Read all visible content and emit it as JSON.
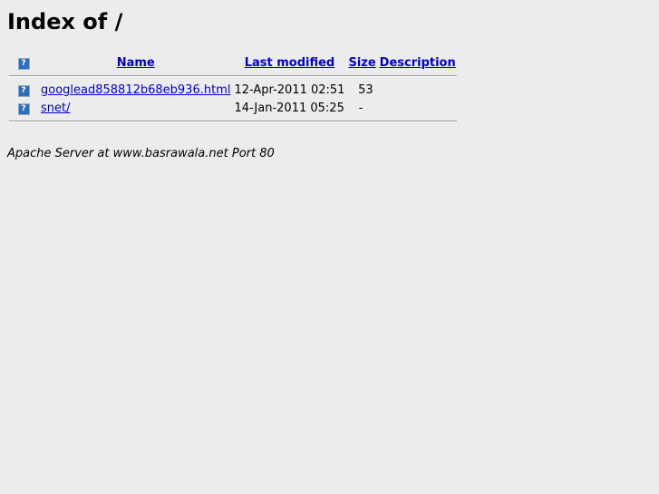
{
  "page": {
    "title": "Index of /"
  },
  "columns": {
    "name": "Name",
    "last_modified": "Last modified",
    "size": "Size",
    "description": "Description"
  },
  "rows": [
    {
      "icon": "unknown-file-icon",
      "name": "googlead858812b68eb936.html",
      "last_modified": "12-Apr-2011 02:51",
      "size": "53",
      "description": ""
    },
    {
      "icon": "unknown-file-icon",
      "name": "snet/",
      "last_modified": "14-Jan-2011 05:25",
      "size": "-",
      "description": ""
    }
  ],
  "footer": {
    "address": "Apache Server at www.basrawala.net Port 80"
  },
  "colors": {
    "background": "#ececec",
    "link": "#0000cc",
    "icon": "#2d6fbe"
  }
}
